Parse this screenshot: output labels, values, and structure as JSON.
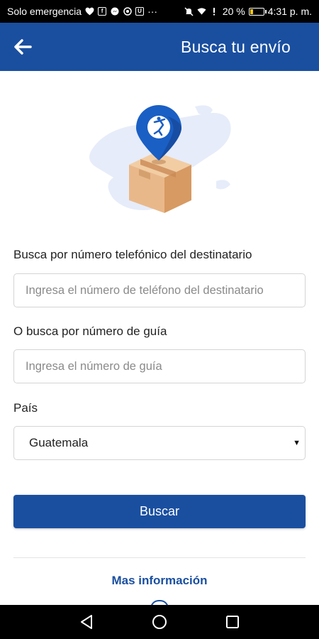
{
  "status_bar": {
    "carrier_text": "Solo emergencia",
    "battery_percent": "20 %",
    "time": "4:31 p. m.",
    "icons_left": [
      "heart-icon",
      "facebook-icon",
      "messenger-icon",
      "whatsapp-icon",
      "app-u-icon",
      "more-dots-icon"
    ],
    "icons_right": [
      "mute-icon",
      "wifi-icon",
      "alert-icon",
      "battery-icon"
    ]
  },
  "app_bar": {
    "title": "Busca tu envío",
    "back_icon": "arrow-left-icon",
    "color": "#1a4fa0"
  },
  "illustration": {
    "name": "box-with-location-pin"
  },
  "form": {
    "phone_label": "Busca por número telefónico del destinatario",
    "phone_placeholder": "Ingresa el número de teléfono del destinatario",
    "guide_label": "O busca por número de guía",
    "guide_placeholder": "Ingresa el número de guía",
    "country_label": "País",
    "country_selected": "Guatemala",
    "search_button": "Buscar"
  },
  "footer": {
    "more_info_link": "Mas información"
  },
  "nav_bar": {
    "buttons": [
      "back-triangle-icon",
      "home-circle-icon",
      "recents-square-icon"
    ]
  }
}
